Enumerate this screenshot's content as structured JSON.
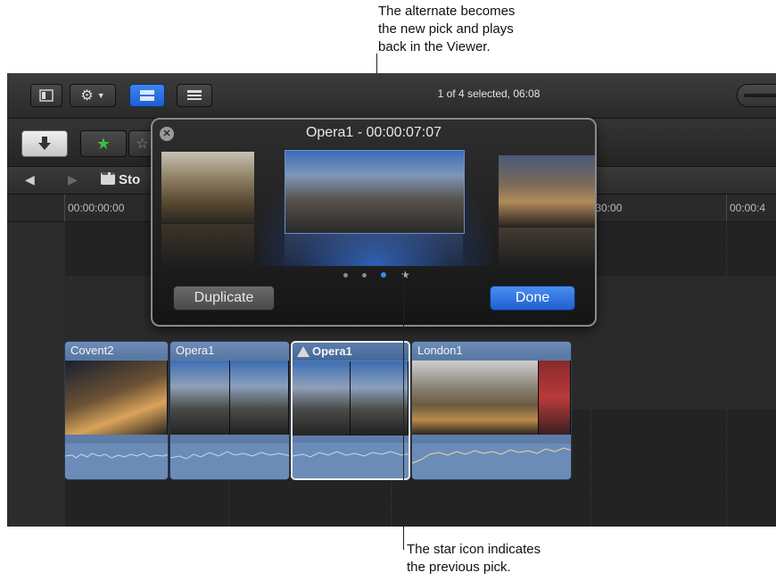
{
  "callouts": {
    "top": "The alternate becomes\nthe new pick and plays\nback in the Viewer.",
    "bottom": "The star icon indicates\nthe previous pick."
  },
  "toolbar": {
    "status_text": "1 of 4 selected, 06:08"
  },
  "nav": {
    "back_icon": "back-arrow-icon",
    "forward_icon": "forward-arrow-icon",
    "project_label": "Sto"
  },
  "ruler": {
    "ticks": [
      "00:00:00:00",
      ":30:00",
      "00:00:4"
    ]
  },
  "audition": {
    "title": "Opera1 - 00:00:07:07",
    "duplicate_label": "Duplicate",
    "done_label": "Done",
    "dots": [
      "dot",
      "dot",
      "current",
      "star"
    ]
  },
  "clips": [
    {
      "name": "Covent2"
    },
    {
      "name": "Opera1"
    },
    {
      "name": "Opera1",
      "audition_badge": true,
      "selected": true
    },
    {
      "name": "London1"
    }
  ],
  "colors": {
    "accent_blue": "#2f6fd6",
    "clip_blue": "#5d7da8",
    "rating_green": "#3fbf3f"
  }
}
